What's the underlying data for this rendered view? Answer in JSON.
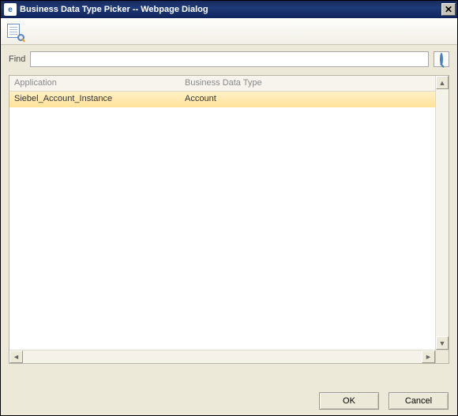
{
  "window": {
    "title": "Business Data Type Picker -- Webpage Dialog"
  },
  "find": {
    "label": "Find",
    "value": ""
  },
  "grid": {
    "columns": {
      "application": "Application",
      "business_data_type": "Business Data Type"
    },
    "selectedIndex": 0,
    "rows": [
      {
        "application": "Siebel_Account_Instance",
        "business_data_type": "Account"
      }
    ]
  },
  "buttons": {
    "ok": "OK",
    "cancel": "Cancel"
  }
}
